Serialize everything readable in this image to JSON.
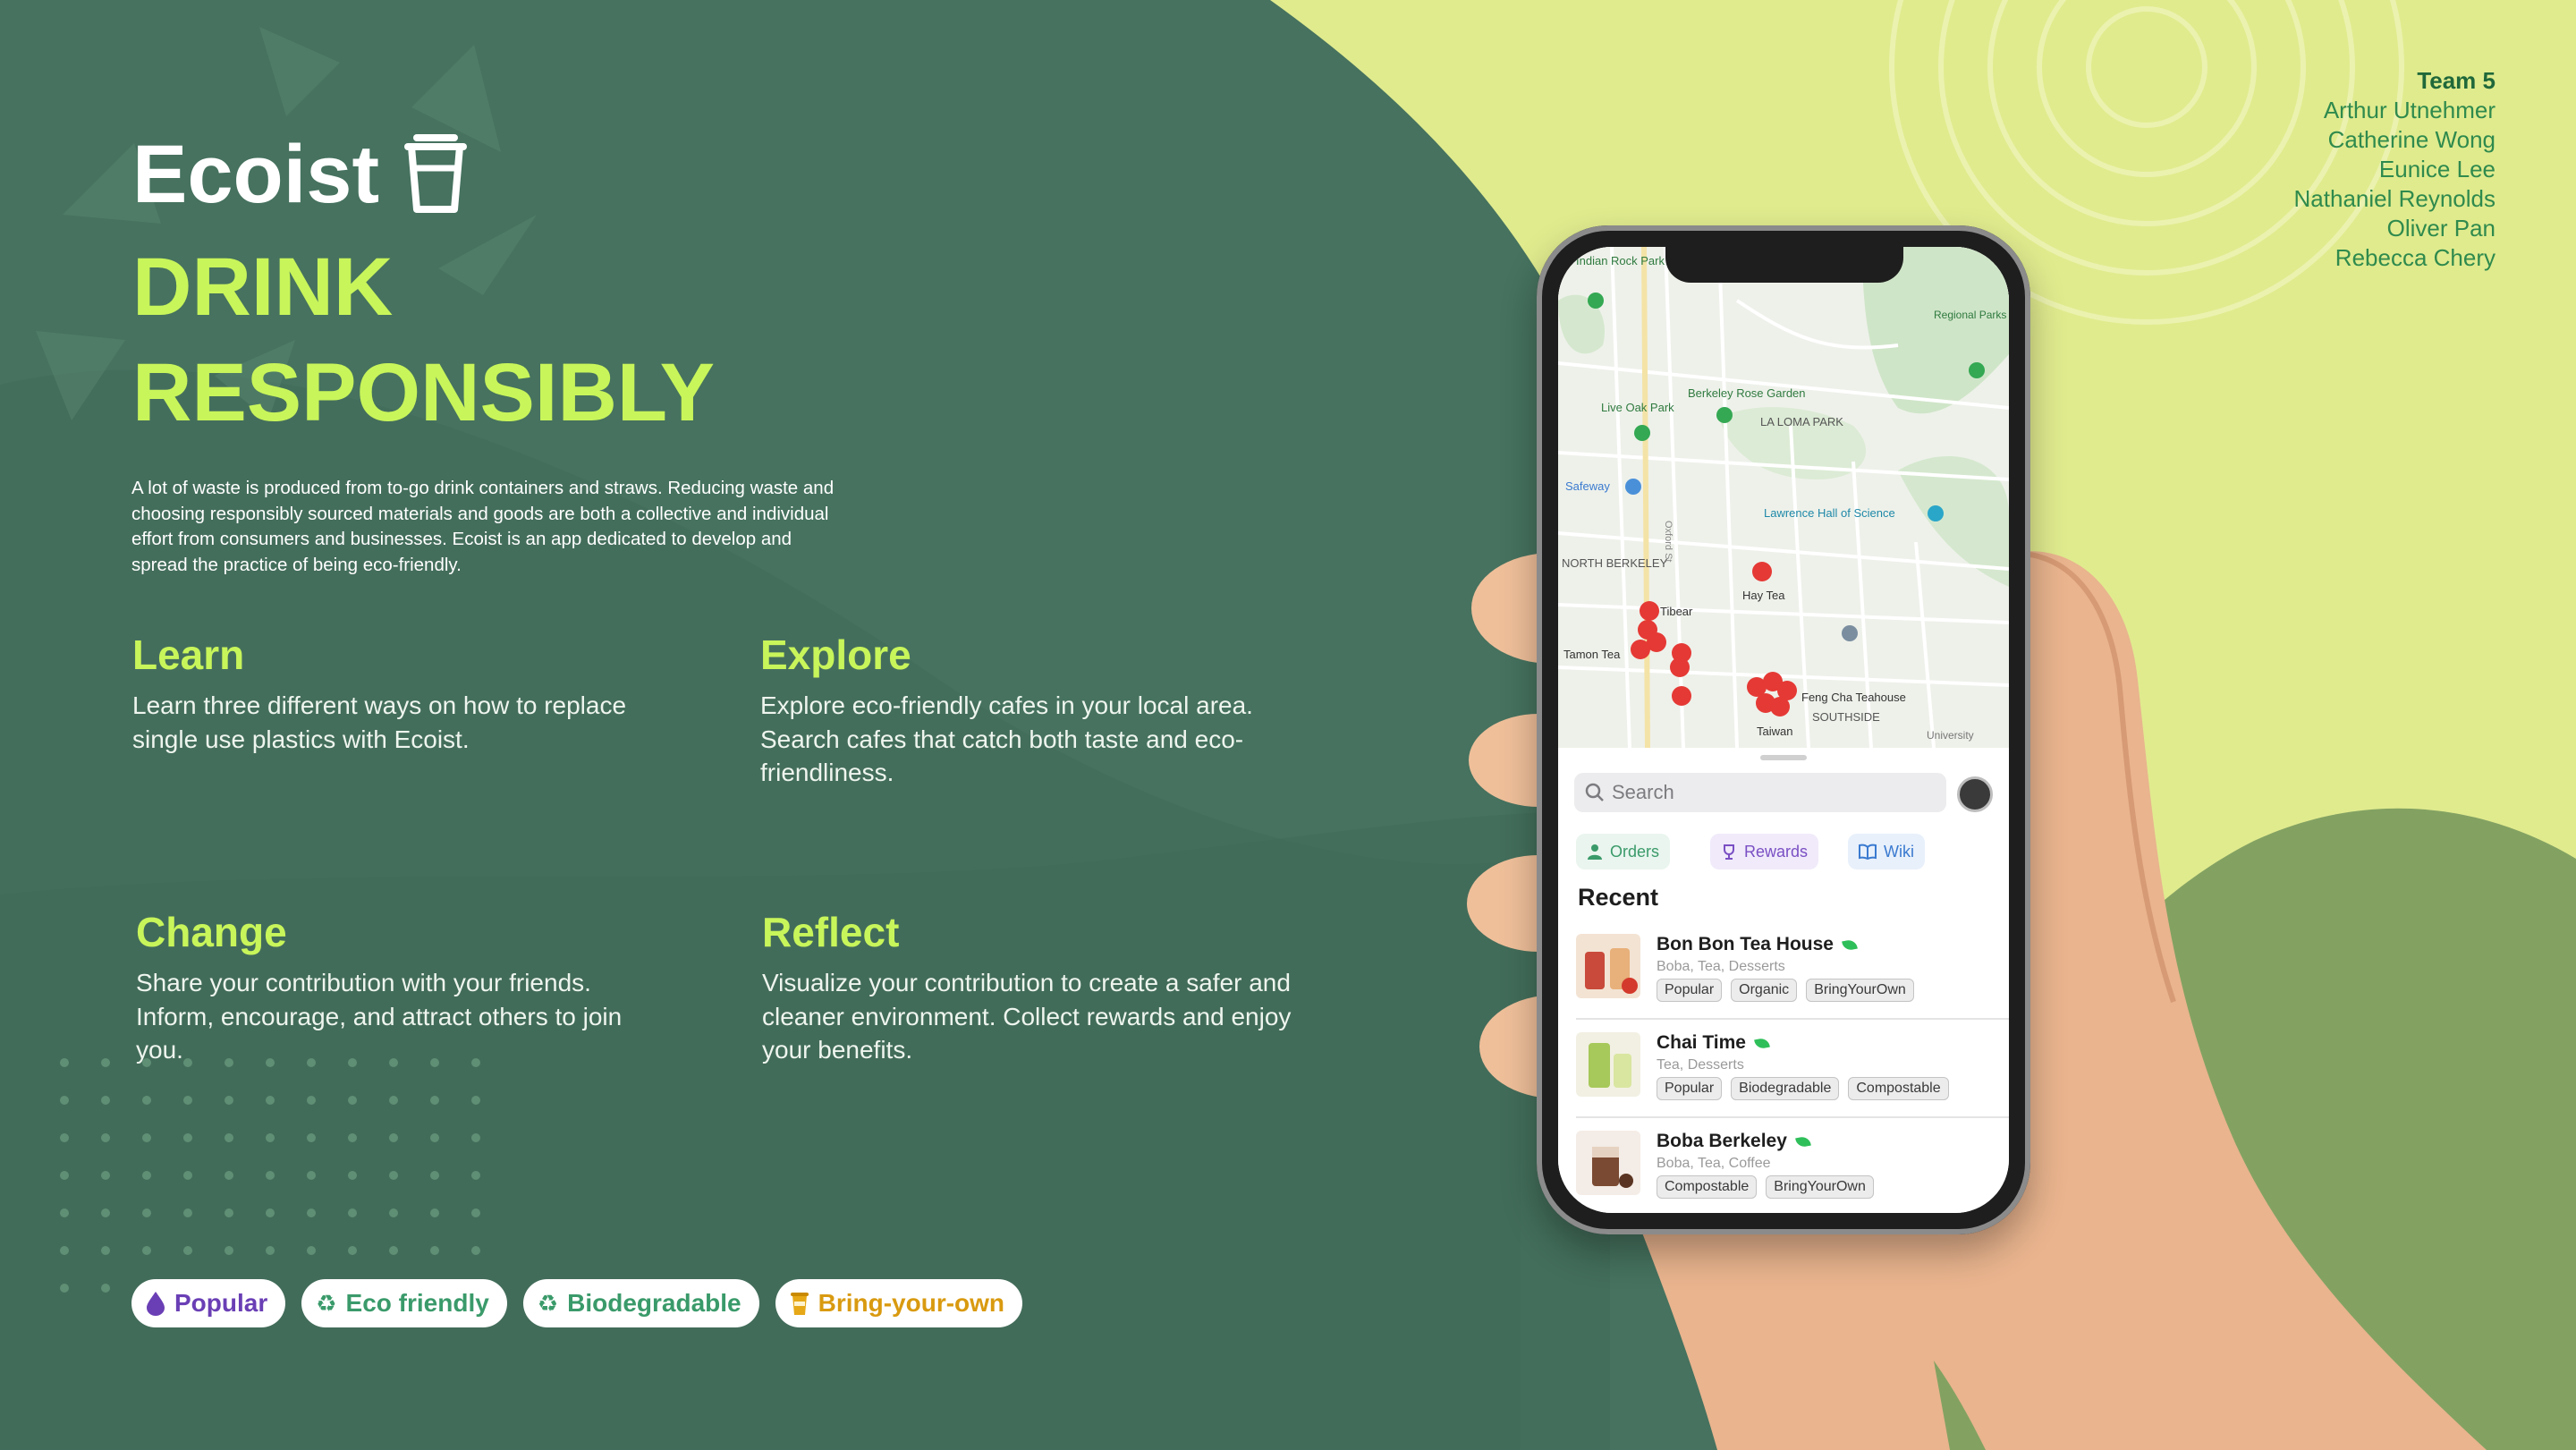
{
  "brand": {
    "name": "Ecoist",
    "tagline": "DRINK RESPONSIBLY",
    "intro": "A lot of waste is produced from to-go drink containers and straws. Reducing waste and choosing responsibly sourced materials and goods are both a collective and individual effort from consumers and businesses. Ecoist is an app dedicated to develop and spread the practice of being eco-friendly.",
    "cup_icon": "cup-icon"
  },
  "sections": [
    {
      "title": "Learn",
      "text": "Learn three different ways on how to replace single use plastics with Ecoist."
    },
    {
      "title": "Explore",
      "text": "Explore eco-friendly cafes in your local area. Search cafes that catch both taste and eco-friendliness."
    },
    {
      "title": "Change",
      "text": "Share your contribution with your friends. Inform, encourage, and attract others to join you."
    },
    {
      "title": "Reflect",
      "text": "Visualize your contribution to create a safer and cleaner environment. Collect rewards and enjoy your benefits."
    }
  ],
  "team": {
    "heading": "Team 5",
    "members": [
      "Arthur Utnehmer",
      "Catherine Wong",
      "Eunice Lee",
      "Nathaniel Reynolds",
      "Oliver Pan",
      "Rebecca Chery"
    ]
  },
  "chips": [
    {
      "label": "Popular",
      "icon": "drop-icon",
      "color": "#6a3fb5"
    },
    {
      "label": "Eco friendly",
      "icon": "recycle-icon",
      "color": "#3a9a6a"
    },
    {
      "label": "Biodegradable",
      "icon": "recycle-icon",
      "color": "#3a9a6a"
    },
    {
      "label": "Bring-your-own",
      "icon": "cup-icon",
      "color": "#d99a10"
    }
  ],
  "app": {
    "map_labels": {
      "indian_rock": "Indian Rock Park",
      "regional_parks": "Regional Parks Botanic Garden",
      "berkeley_rose": "Berkeley Rose Garden",
      "live_oak": "Live Oak Park",
      "la_loma": "LA LOMA PARK",
      "safeway": "Safeway",
      "lawrence": "Lawrence Hall of Science",
      "north_berkeley": "NORTH BERKELEY",
      "hay_tea": "Hay Tea",
      "tibear": "Tibear",
      "tamon_tea": "Tamon Tea",
      "feng_cha": "Feng Cha Teahouse",
      "southside": "SOUTHSIDE",
      "taiwan": "Taiwan",
      "university": "University",
      "oxford": "Oxford St"
    },
    "search_placeholder": "Search",
    "tabs": [
      {
        "label": "Orders",
        "icon": "person-icon",
        "color": "#3a9a6a",
        "bg": "#e9f5ee"
      },
      {
        "label": "Rewards",
        "icon": "trophy-icon",
        "color": "#7a4fc4",
        "bg": "#f0eafa"
      },
      {
        "label": "Wiki",
        "icon": "book-icon",
        "color": "#3a7ad0",
        "bg": "#e8f0fb"
      }
    ],
    "recent_heading": "Recent",
    "cafes": [
      {
        "name": "Bon Bon Tea House",
        "sub": "Boba, Tea, Desserts",
        "tags": [
          "Popular",
          "Organic",
          "BringYourOwn"
        ]
      },
      {
        "name": "Chai Time",
        "sub": "Tea, Desserts",
        "tags": [
          "Popular",
          "Biodegradable",
          "Compostable"
        ]
      },
      {
        "name": "Boba Berkeley",
        "sub": "Boba, Tea, Coffee",
        "tags": [
          "Compostable",
          "BringYourOwn"
        ]
      }
    ]
  },
  "colors": {
    "bg_dark_green": "#46725f",
    "accent_lime": "#c8f55a",
    "light_yellow_green": "#e0eb8e",
    "mid_green": "#83a262"
  }
}
